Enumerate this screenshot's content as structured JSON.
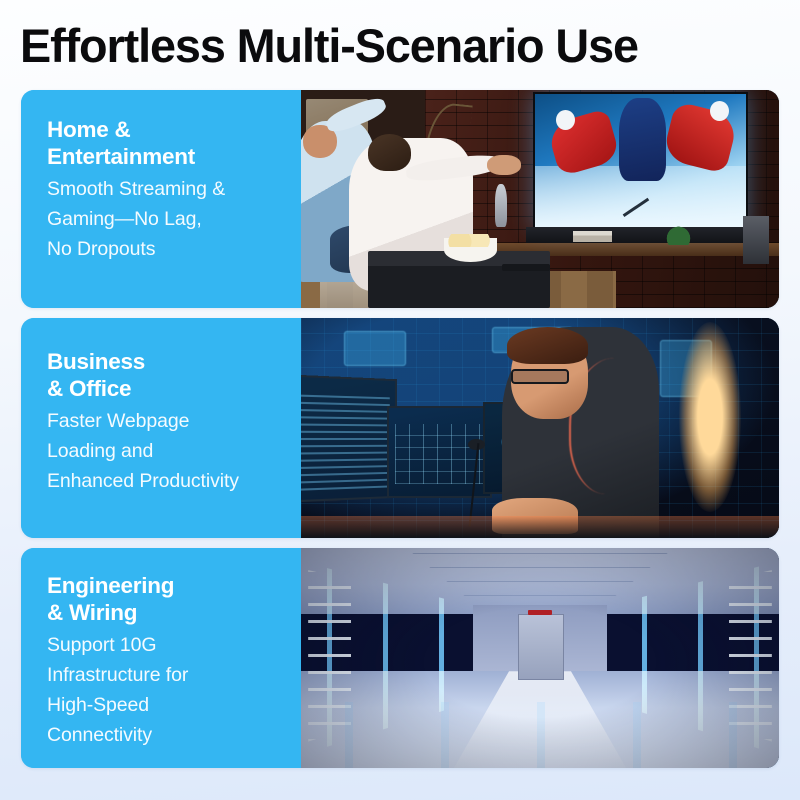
{
  "page": {
    "title": "Effortless Multi-Scenario Use",
    "background_color": "#f2f7fd",
    "accent_color": "#34b6f2"
  },
  "cards": [
    {
      "heading": "Home &\nEntertainment",
      "body": "Smooth Streaming &\nGaming—No Lag,\nNo Dropouts",
      "image_alt": "living-room-tv-hockey-scene"
    },
    {
      "heading": "Business\n& Office",
      "body": "Faster Webpage\nLoading and\nEnhanced Productivity",
      "image_alt": "control-room-monitors-scene"
    },
    {
      "heading": "Engineering\n& Wiring",
      "body": "Support 10G\nInfrastructure for\nHigh-Speed\nConnectivity",
      "image_alt": "data-center-server-corridor-scene"
    }
  ]
}
